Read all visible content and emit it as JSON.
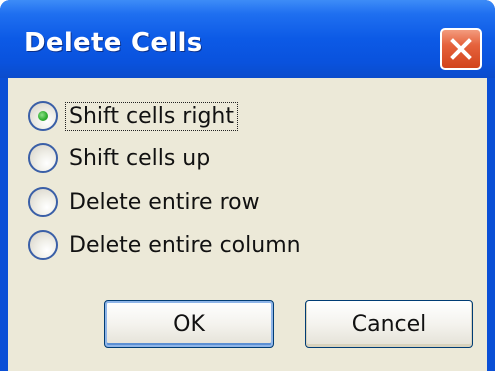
{
  "dialog": {
    "title": "Delete Cells",
    "options": [
      {
        "label": "Shift cells right",
        "checked": true
      },
      {
        "label": "Shift cells up",
        "checked": false
      },
      {
        "label": "Delete entire row",
        "checked": false
      },
      {
        "label": "Delete entire column",
        "checked": false
      }
    ],
    "ok_label": "OK",
    "cancel_label": "Cancel",
    "close_icon": "close-icon",
    "colors": {
      "titlebar": "#0a52dd",
      "client": "#ece9d8",
      "close_button": "#d2441c",
      "radio_selected": "#33b033"
    }
  }
}
